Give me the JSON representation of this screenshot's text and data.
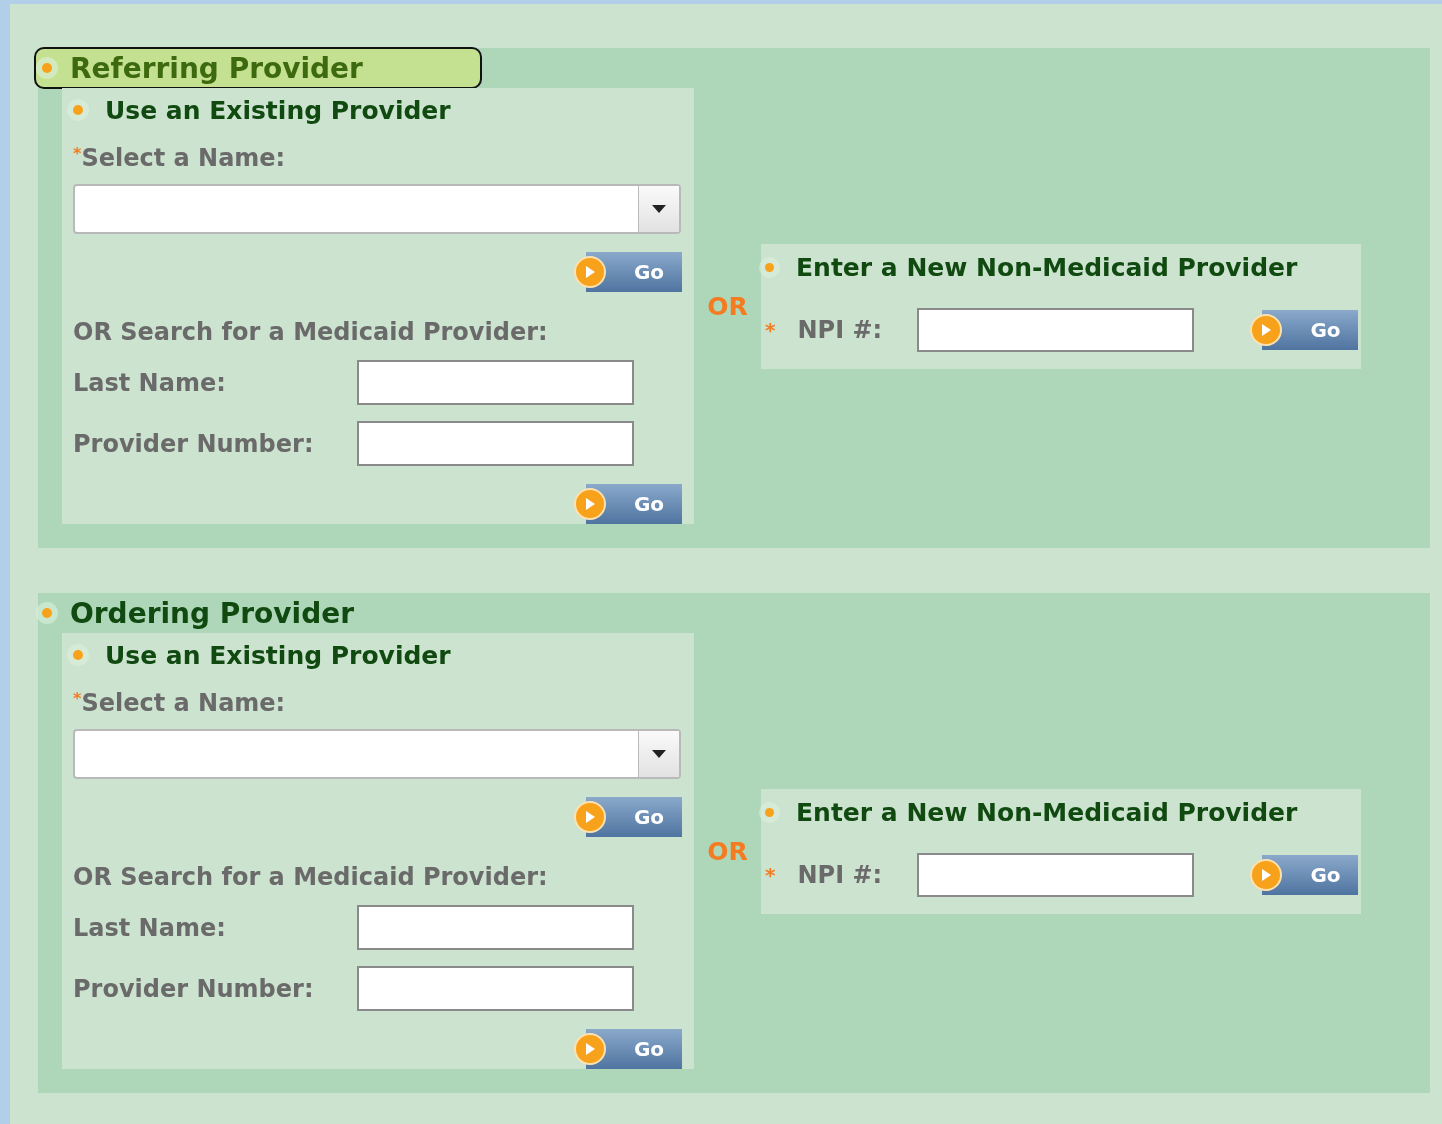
{
  "sections": [
    {
      "title": "Referring Provider",
      "highlighted": true,
      "existing": {
        "title": "Use an Existing Provider",
        "required_mark": "*",
        "select_label": "Select a Name:",
        "go": "Go",
        "search_label": "OR Search for a Medicaid Provider:",
        "fields": [
          {
            "label": "Last Name:"
          },
          {
            "label": "Provider Number:"
          }
        ],
        "search_go": "Go"
      },
      "separator": "OR",
      "new": {
        "title": "Enter a New Non-Medicaid Provider",
        "required_mark": "*",
        "field_label": "NPI #:",
        "go": "Go"
      }
    },
    {
      "title": "Ordering Provider",
      "highlighted": false,
      "existing": {
        "title": "Use an Existing Provider",
        "required_mark": "*",
        "select_label": "Select a Name:",
        "go": "Go",
        "search_label": "OR Search for a Medicaid Provider:",
        "fields": [
          {
            "label": "Last Name:"
          },
          {
            "label": "Provider Number:"
          }
        ],
        "search_go": "Go"
      },
      "separator": "OR",
      "new": {
        "title": "Enter a New Non-Medicaid Provider",
        "required_mark": "*",
        "field_label": "NPI #:",
        "go": "Go"
      }
    }
  ]
}
